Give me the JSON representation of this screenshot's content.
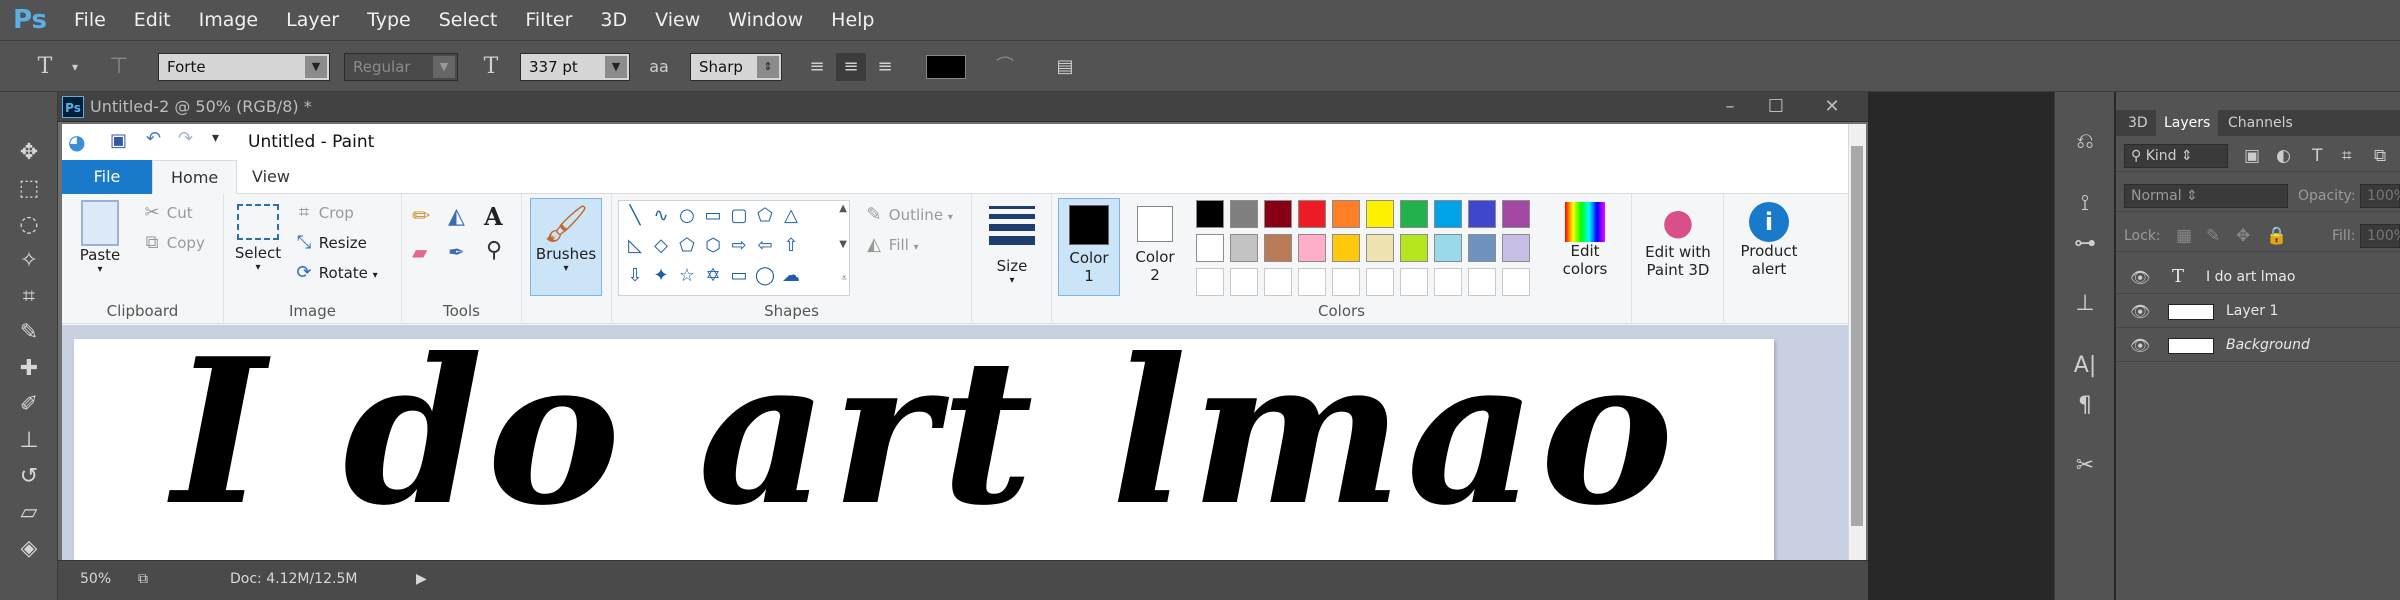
{
  "photoshop": {
    "logo": "Ps",
    "menu": [
      "File",
      "Edit",
      "Image",
      "Layer",
      "Type",
      "Select",
      "Filter",
      "3D",
      "View",
      "Window",
      "Help"
    ],
    "options": {
      "font_family": "Forte",
      "font_style": "Regular",
      "font_size": "337 pt",
      "aa_label": "a",
      "antialias": "Sharp",
      "text_color": "#000000"
    },
    "document": {
      "title": "Untitled-2 @ 50% (RGB/8) *",
      "zoom": "50%",
      "doc_info": "Doc: 4.12M/12.5M"
    },
    "panels": {
      "tabs": [
        "3D",
        "Layers",
        "Channels"
      ],
      "active_tab": "Layers",
      "kind_label": "Kind",
      "blend_mode": "Normal",
      "opacity_label": "Opacity:",
      "opacity_value": "100%",
      "lock_label": "Lock:",
      "fill_label": "Fill:",
      "fill_value": "100%",
      "layers": [
        {
          "name": "I do art lmao",
          "type": "text"
        },
        {
          "name": "Layer 1",
          "type": "pixel"
        },
        {
          "name": "Background",
          "type": "background"
        }
      ]
    }
  },
  "paint": {
    "title": "Untitled - Paint",
    "tabs": [
      "File",
      "Home",
      "View"
    ],
    "clipboard": {
      "paste": "Paste",
      "cut": "Cut",
      "copy": "Copy",
      "label": "Clipboard"
    },
    "image": {
      "select": "Select",
      "crop": "Crop",
      "resize": "Resize",
      "rotate": "Rotate",
      "label": "Image"
    },
    "tools": {
      "label": "Tools"
    },
    "brushes": {
      "label": "Brushes"
    },
    "shapes": {
      "outline": "Outline",
      "fill": "Fill",
      "label": "Shapes"
    },
    "size": {
      "label": "Size"
    },
    "colors": {
      "color1": "Color\n1",
      "color1_a": "Color",
      "color1_b": "1",
      "color2_a": "Color",
      "color2_b": "2",
      "edit_a": "Edit",
      "edit_b": "colors",
      "label": "Colors",
      "palette_row1": [
        "#000000",
        "#7f7f7f",
        "#880015",
        "#ed1c24",
        "#ff7f27",
        "#fff200",
        "#22b14c",
        "#00a2e8",
        "#3f48cc",
        "#a349a4"
      ],
      "palette_row2": [
        "#ffffff",
        "#c3c3c3",
        "#b97a57",
        "#ffaec9",
        "#ffc90e",
        "#efe4b0",
        "#b5e61d",
        "#99d9ea",
        "#7092be",
        "#c8bfe7"
      ]
    },
    "paint3d_a": "Edit with",
    "paint3d_b": "Paint 3D",
    "alert_a": "Product",
    "alert_b": "alert",
    "canvas_text": "I do art lmao"
  }
}
